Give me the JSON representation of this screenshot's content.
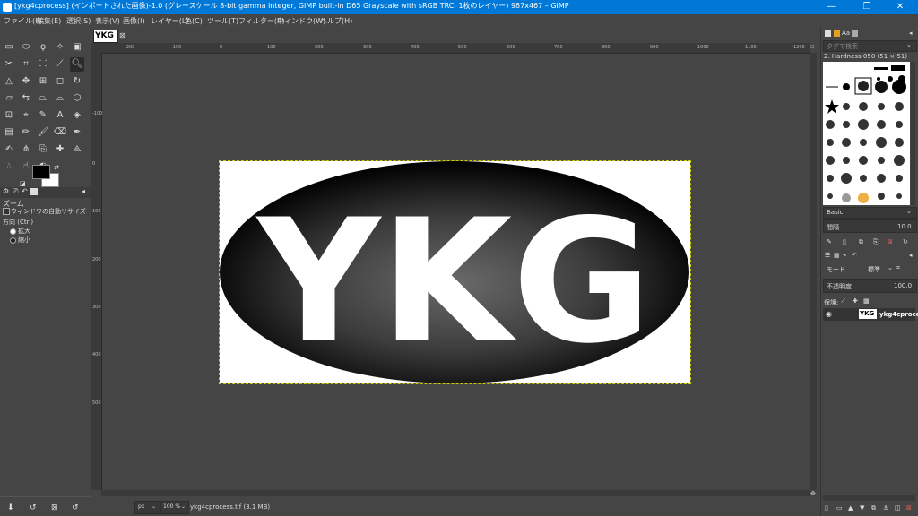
{
  "window": {
    "title": "[ykg4cprocess] (インポートされた画像)-1.0 (グレースケール 8-bit gamma integer, GIMP built-in D65 Grayscale with sRGB TRC, 1枚のレイヤー) 987x467 – GIMP",
    "minimize": "—",
    "maximize": "❐",
    "close": "✕"
  },
  "menu": [
    "ファイル(F)",
    "編集(E)",
    "選択(S)",
    "表示(V)",
    "画像(I)",
    "レイヤー(L)",
    "色(C)",
    "ツール(T)",
    "フィルター(R)",
    "ウィンドウ(W)",
    "ヘルプ(H)"
  ],
  "toolbox": {
    "tool_options_title": "ズーム",
    "auto_resize_label": "ウィンドウの自動リサイズ",
    "direction_label": "方向 (Ctrl)",
    "zoom_in_label": "拡大",
    "zoom_out_label": "縮小"
  },
  "canvas": {
    "tab_thumb_text": "YKG",
    "ruler_h_ticks": [
      "-200",
      "-100",
      "0",
      "100",
      "200",
      "300",
      "400",
      "500",
      "600",
      "700",
      "800",
      "900",
      "1000",
      "1100",
      "1200"
    ],
    "ruler_v_ticks": [
      "-100",
      "0",
      "100",
      "200",
      "300",
      "400",
      "500"
    ],
    "image_text": "YKG"
  },
  "status": {
    "unit": "px",
    "zoom": "100 %",
    "file_info": "ykg4cprocess.tif (3.1 MB)"
  },
  "brushes": {
    "filter_placeholder": "タグで検索",
    "brush_name": "2. Hardness 050 (51 × 51)",
    "preset": "Basic,",
    "spacing_label": "間隔",
    "spacing_value": "10.0"
  },
  "layers": {
    "mode_label": "モード",
    "mode_value": "標準",
    "opacity_label": "不透明度",
    "opacity_value": "100.0",
    "lock_label": "保護:",
    "layer_name": "ykg4cprocess",
    "layer_thumb_text": "YKG"
  },
  "colors": {
    "titlebar": "#0078d7",
    "panel": "#454545",
    "ruler": "#3a3a3a",
    "selection_border": "#cccc00"
  }
}
